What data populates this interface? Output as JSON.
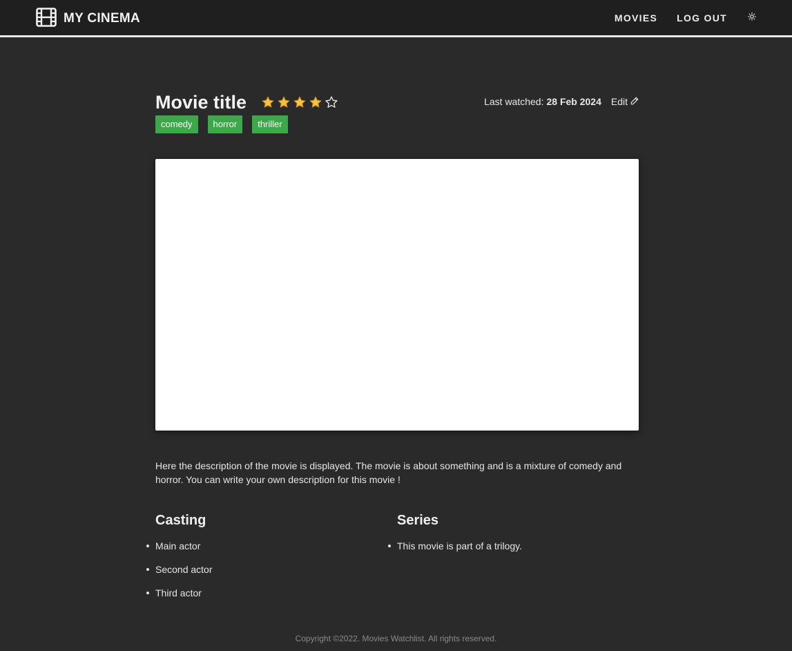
{
  "nav": {
    "brand": "MY CINEMA",
    "brand_icon": "film-icon",
    "links": [
      "MOVIES",
      "LOG OUT"
    ],
    "theme_icon": "sun-icon"
  },
  "movie": {
    "title": "Movie title",
    "rating": 4,
    "rating_max": 5,
    "last_watched_label": "Last watched:",
    "last_watched_date": "28 Feb 2024",
    "edit_label": "Edit",
    "tags": [
      "comedy",
      "horror",
      "thriller"
    ],
    "description": "Here the description of the movie is displayed. The movie is about something and is a mixture of comedy and horror. You can write your own description for this movie !"
  },
  "casting": {
    "title": "Casting",
    "actors": [
      "Main actor",
      "Second actor",
      "Third actor"
    ]
  },
  "series": {
    "title": "Series",
    "items": [
      "This movie is part of a trilogy."
    ]
  },
  "footer": {
    "text": "Copyright ©2022. Movies Watchlist. All rights reserved."
  },
  "colors": {
    "background": "#2a2a2a",
    "navbar": "#1f1f1f",
    "tag": "#3da84a",
    "star": "#f5c242"
  }
}
